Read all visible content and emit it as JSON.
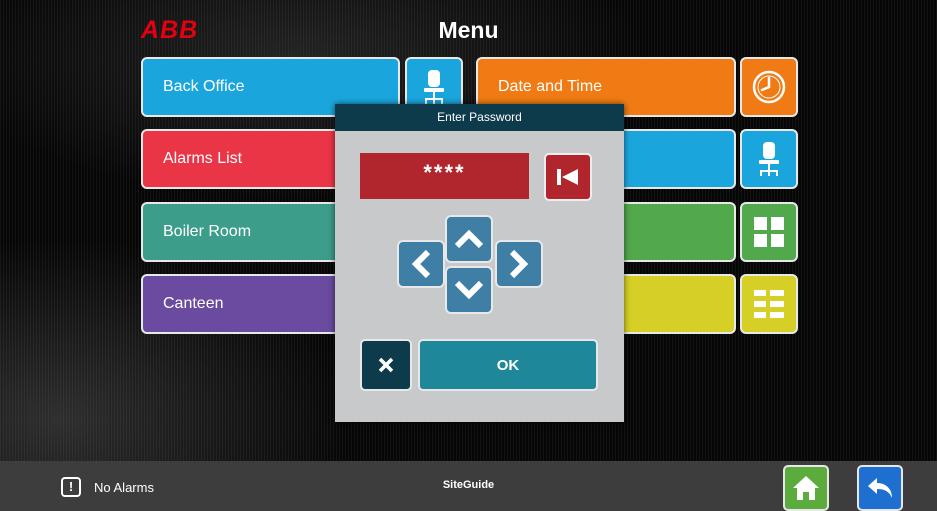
{
  "header": {
    "logo_text": "ABB",
    "title": "Menu"
  },
  "menu": {
    "tiles": [
      {
        "label": "Back Office",
        "icon": "office-chair-icon",
        "color": "#1aa6dd",
        "icon_color": "#1aa6dd"
      },
      {
        "label": "Date and Time",
        "icon": "clock-icon",
        "color": "#f07b14",
        "icon_color": "#f07b14"
      },
      {
        "label": "Alarms List",
        "icon": "",
        "color": "#ea3546"
      },
      {
        "label": "",
        "icon": "office-chair-icon",
        "color": "#1aa6dd",
        "icon_color": "#1aa6dd"
      },
      {
        "label": "Boiler Room",
        "icon": "",
        "color": "#3c9d8a"
      },
      {
        "label": "",
        "icon": "grid-icon",
        "color": "#52a94b",
        "icon_color": "#52a94b"
      },
      {
        "label": "Canteen",
        "icon": "",
        "color": "#6a4b9f"
      },
      {
        "label": "",
        "icon": "list-icon",
        "color": "#d5cf26",
        "icon_color": "#d5cf26"
      }
    ]
  },
  "dialog": {
    "title": "Enter Password",
    "password_value": "****",
    "ok_label": "OK"
  },
  "footer": {
    "alarm_icon_glyph": "!",
    "alarm_status": "No Alarms",
    "site_name": "SiteGuide",
    "home_color": "#5cab3d",
    "back_color": "#1f6fd0"
  }
}
